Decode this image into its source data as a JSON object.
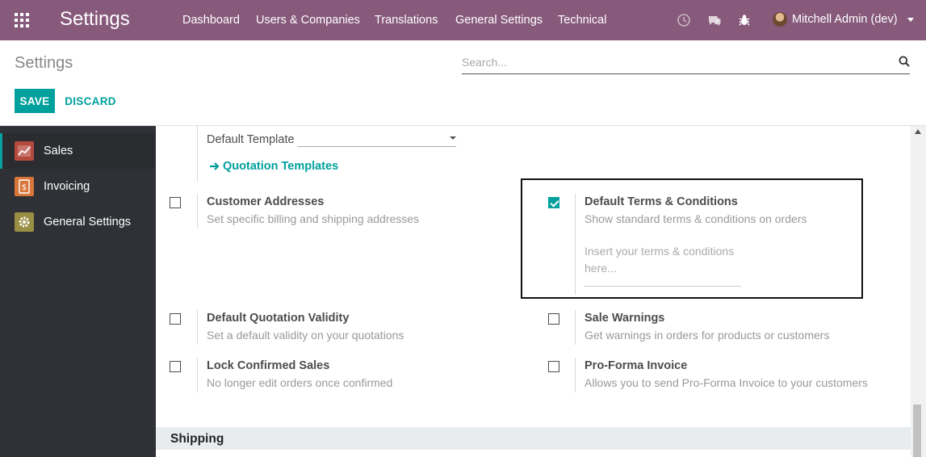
{
  "navbar": {
    "brand": "Settings",
    "menu": [
      "Dashboard",
      "Users & Companies",
      "Translations",
      "General Settings",
      "Technical"
    ],
    "icons": [
      "clock-icon",
      "chat-icon",
      "bug-icon"
    ],
    "user": "Mitchell Admin (dev)",
    "color": "#875a7b"
  },
  "control_panel": {
    "title": "Settings",
    "search_placeholder": "Search...",
    "save_label": "SAVE",
    "discard_label": "DISCARD",
    "accent": "#00a09d"
  },
  "sidebar": {
    "items": [
      {
        "label": "Sales",
        "icon": "sales-icon",
        "active": true,
        "color": "#c0392b"
      },
      {
        "label": "Invoicing",
        "icon": "invoicing-icon",
        "active": false,
        "color": "#e67e22"
      },
      {
        "label": "General Settings",
        "icon": "gear-icon",
        "active": false,
        "color": "#9a8e44"
      }
    ]
  },
  "main": {
    "default_template": {
      "label": "Default Template",
      "value": "",
      "link": "Quotation Templates"
    },
    "customer_addresses": {
      "title": "Customer Addresses",
      "description": "Set specific billing and shipping addresses",
      "checked": false
    },
    "default_terms": {
      "title": "Default Terms & Conditions",
      "description": "Show standard terms & conditions on orders",
      "placeholder": "Insert your terms & conditions here...",
      "checked": true
    },
    "quotation_validity": {
      "title": "Default Quotation Validity",
      "description": "Set a default validity on your quotations",
      "checked": false
    },
    "sale_warnings": {
      "title": "Sale Warnings",
      "description": "Get warnings in orders for products or customers",
      "checked": false
    },
    "lock_confirmed": {
      "title": "Lock Confirmed Sales",
      "description": "No longer edit orders once confirmed",
      "checked": false
    },
    "pro_forma": {
      "title": "Pro-Forma Invoice",
      "description": "Allows you to send Pro-Forma Invoice to your customers",
      "checked": false
    },
    "section_shipping": "Shipping"
  }
}
